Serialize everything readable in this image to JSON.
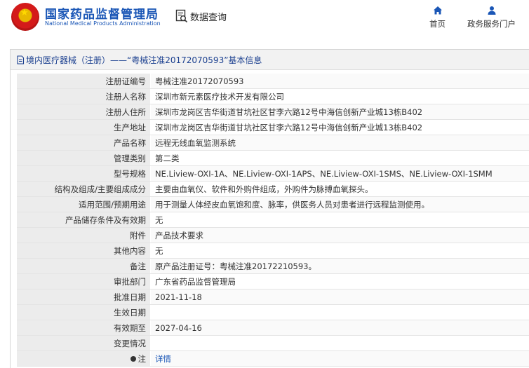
{
  "header": {
    "logo_cn": "国家药品监督管理局",
    "logo_en": "National Medical Products Administration",
    "search_label": "数据查询",
    "nav": [
      {
        "label": "首页",
        "icon": "home-icon"
      },
      {
        "label": "政务服务门户",
        "icon": "user-icon"
      }
    ]
  },
  "panel": {
    "title": "境内医疗器械（注册）——“粤械注准20172070593”基本信息"
  },
  "rows": [
    {
      "key": "注册证编号",
      "value": "粤械注准20172070593"
    },
    {
      "key": "注册人名称",
      "value": "深圳市新元素医疗技术开发有限公司"
    },
    {
      "key": "注册人住所",
      "value": "深圳市龙岗区吉华街道甘坑社区甘李六路12号中海信创新产业城13栋B402"
    },
    {
      "key": "生产地址",
      "value": "深圳市龙岗区吉华街道甘坑社区甘李六路12号中海信创新产业城13栋B402"
    },
    {
      "key": "产品名称",
      "value": "远程无线血氧监测系统"
    },
    {
      "key": "管理类别",
      "value": "第二类"
    },
    {
      "key": "型号规格",
      "value": "NE.Liview-OXI-1A、NE.Liview-OXI-1APS、NE.Liview-OXI-1SMS、NE.Liview-OXI-1SMM"
    },
    {
      "key": "结构及组成/主要组成成分",
      "value": "主要由血氧仪、软件和外购件组成，外购件为脉搏血氧探头。"
    },
    {
      "key": "适用范围/预期用途",
      "value": "用于测量人体经皮血氧饱和度、脉率，供医务人员对患者进行远程监测使用。"
    },
    {
      "key": "产品储存条件及有效期",
      "value": "无"
    },
    {
      "key": "附件",
      "value": "产品技术要求"
    },
    {
      "key": "其他内容",
      "value": "无"
    },
    {
      "key": "备注",
      "value": "原产品注册证号：粤械注准20172210593。"
    },
    {
      "key": "审批部门",
      "value": "广东省药品监督管理局"
    },
    {
      "key": "批准日期",
      "value": "2021-11-18"
    },
    {
      "key": "生效日期",
      "value": ""
    },
    {
      "key": "有效期至",
      "value": "2027-04-16"
    },
    {
      "key": "变更情况",
      "value": ""
    }
  ],
  "note_row": {
    "key": "注",
    "value": "详情"
  }
}
